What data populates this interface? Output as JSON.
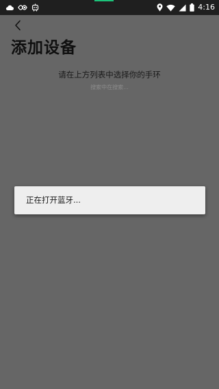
{
  "status_bar": {
    "time": "4:16",
    "left_icons": [
      "cloud-icon",
      "infinity-eye-icon",
      "robot-icon"
    ],
    "right_icons": [
      "location-icon",
      "wifi-icon",
      "signal-icon",
      "battery-icon"
    ],
    "accent_color": "#1cc37a"
  },
  "header": {
    "back_icon": "chevron-left-icon",
    "title": "添加设备"
  },
  "main": {
    "instruction": "请在上方列表中选择你的手环",
    "searching_text": "搜索中在搜索..."
  },
  "dialog": {
    "message": "正在打开蓝牙..."
  },
  "colors": {
    "overlay_background": "#666666",
    "status_bar_background": "#1f1f1f",
    "dialog_background": "#eeeeee"
  }
}
